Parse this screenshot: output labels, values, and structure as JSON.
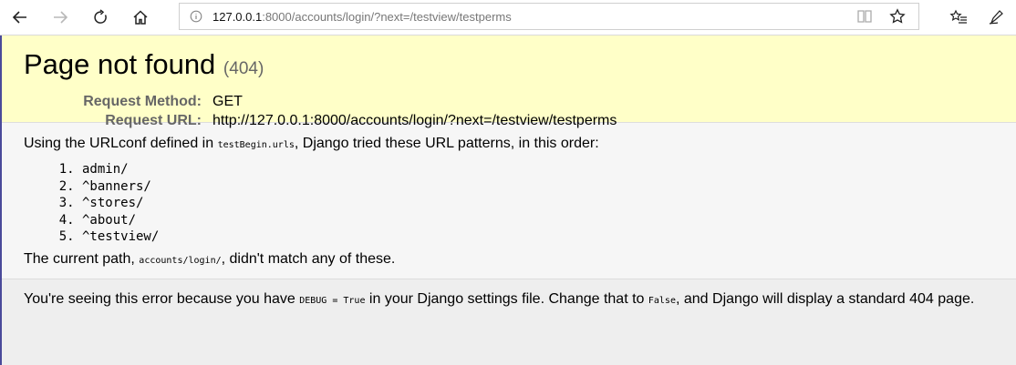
{
  "browser": {
    "url_host": "127.0.0.1",
    "url_rest": ":8000/accounts/login/?next=/testview/testperms"
  },
  "summary": {
    "title": "Page not found",
    "status_code": "(404)",
    "request_method_label": "Request Method:",
    "request_method_value": "GET",
    "request_url_label": "Request URL:",
    "request_url_value": "http://127.0.0.1:8000/accounts/login/?next=/testview/testperms"
  },
  "info": {
    "intro_before": "Using the URLconf defined in ",
    "urlconf": "testBegin.urls",
    "intro_after": ", Django tried these URL patterns, in this order:",
    "patterns": [
      "admin/",
      "^banners/",
      "^stores/",
      "^about/",
      "^testview/"
    ],
    "current_before": "The current path, ",
    "current_path": "accounts/login/",
    "current_after": ", didn't match any of these."
  },
  "explanation": {
    "part1": "You're seeing this error because you have ",
    "debug_code": "DEBUG = True",
    "part2": " in your Django settings file. Change that to ",
    "false_code": "False",
    "part3": ", and Django will display a standard 404 page."
  }
}
